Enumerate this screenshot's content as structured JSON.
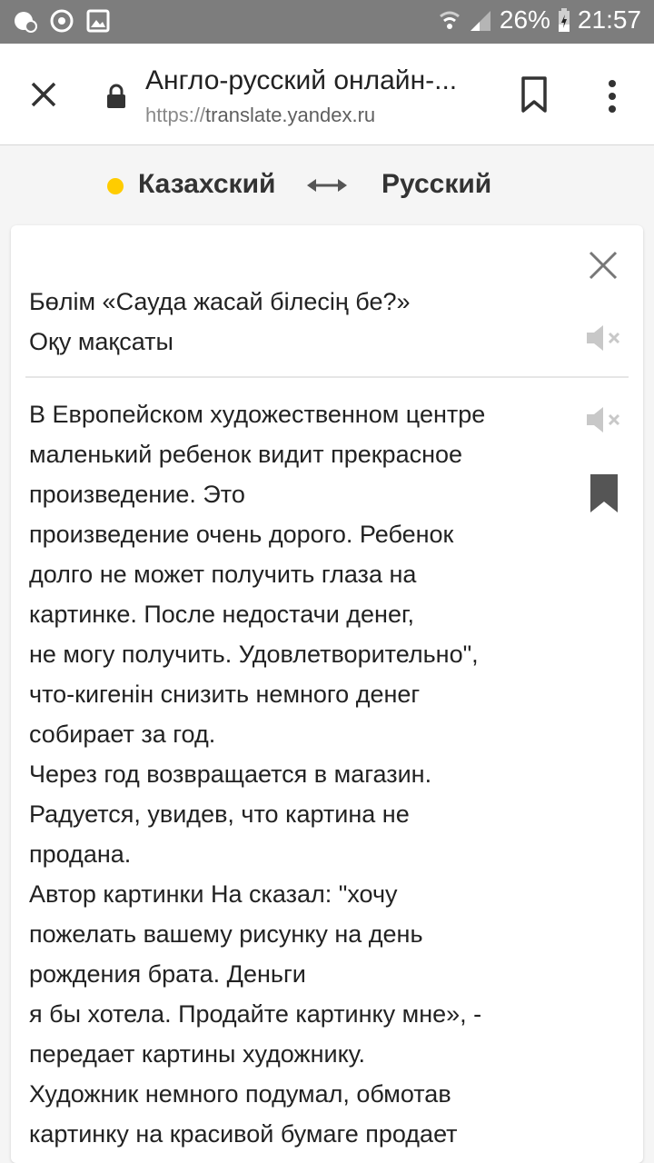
{
  "status_bar": {
    "battery": "26%",
    "time": "21:57",
    "icons": [
      "notification-icon",
      "sync-icon",
      "gallery-icon",
      "wifi-icon",
      "signal-icon",
      "battery-charging-icon"
    ]
  },
  "browser": {
    "page_title": "Англо-русский онлайн-...",
    "url_scheme": "https://",
    "url_host": "translate.yandex.ru",
    "icons": [
      "close-icon",
      "lock-icon",
      "bookmark-icon",
      "more-vert-icon"
    ]
  },
  "languages": {
    "source": "Казахский",
    "target": "Русский",
    "swap_icon": "swap-arrows-icon",
    "accent_color": "#ffcc00"
  },
  "translation": {
    "source_text": "Бөлім «Сауда жасай білесің бе?»\nОқу мақсаты",
    "translated_text": "В Европейском художественном центре\nмаленький ребенок видит прекрасное\nпроизведение. Это\nпроизведение очень дорого. Ребенок\nдолго не может получить глаза на\nкартинке. После недостачи денег,\nне могу получить. Удовлетворительно\",\nчто-кигенін снизить немного денег\nсобирает за год.\nЧерез год возвращается в магазин.\nРадуется, увидев, что картина не\nпродана.\nАвтор картинки На сказал: \"хочу\nпожелать вашему рисунку на день\nрождения брата. Деньги\nя бы хотела. Продайте картинку мне», -\nпередает картины художнику.\nХудожник немного подумал, обмотав\nкартинку на красивой бумаге продает"
  }
}
